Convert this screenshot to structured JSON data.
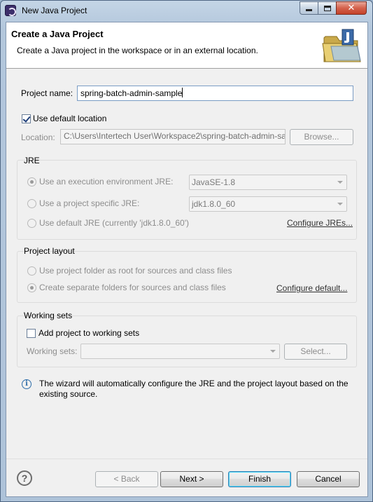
{
  "window": {
    "title": "New Java Project"
  },
  "banner": {
    "title": "Create a Java Project",
    "description": "Create a Java project in the workspace or in an external location."
  },
  "project": {
    "name_label": "Project name:",
    "name_value": "spring-batch-admin-sample",
    "use_default_location_label": "Use default location",
    "use_default_location_checked": true,
    "location_label": "Location:",
    "location_value": "C:\\Users\\Intertech User\\Workspace2\\spring-batch-admin-sa",
    "browse_label": "Browse..."
  },
  "jre": {
    "group_title": "JRE",
    "options": [
      {
        "label": "Use an execution environment JRE:",
        "selected": true,
        "combo_value": "JavaSE-1.8"
      },
      {
        "label": "Use a project specific JRE:",
        "selected": false,
        "combo_value": "jdk1.8.0_60"
      },
      {
        "label": "Use default JRE (currently 'jdk1.8.0_60')",
        "selected": false
      }
    ],
    "configure_link": "Configure JREs..."
  },
  "layout": {
    "group_title": "Project layout",
    "options": [
      {
        "label": "Use project folder as root for sources and class files",
        "selected": false
      },
      {
        "label": "Create separate folders for sources and class files",
        "selected": true
      }
    ],
    "configure_link": "Configure default..."
  },
  "working_sets": {
    "group_title": "Working sets",
    "add_label": "Add project to working sets",
    "add_checked": false,
    "sets_label": "Working sets:",
    "sets_value": "",
    "select_label": "Select..."
  },
  "info": {
    "message": "The wizard will automatically configure the JRE and the project layout based on the existing source."
  },
  "footer": {
    "back_label": "< Back",
    "next_label": "Next >",
    "finish_label": "Finish",
    "cancel_label": "Cancel"
  },
  "colors": {
    "link": "#333333",
    "disabled_text": "#8d8d8d",
    "default_button_border": "#3c7fb1"
  }
}
